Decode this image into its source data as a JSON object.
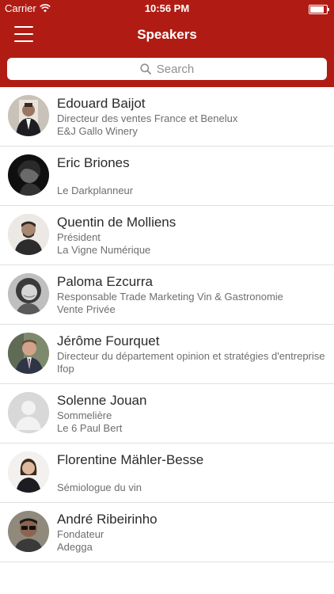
{
  "status_bar": {
    "carrier": "Carrier",
    "time": "10:56 PM",
    "battery_level": 0.95
  },
  "nav": {
    "title": "Speakers"
  },
  "search": {
    "placeholder": "Search"
  },
  "colors": {
    "header": "#b01c14",
    "text_secondary": "#6e6e6e"
  },
  "speakers": [
    {
      "name": "Edouard Baijot",
      "role": "Directeur des ventes France et Benelux",
      "company": "E&J Gallo Winery"
    },
    {
      "name": "Eric Briones",
      "role": "",
      "company": "Le Darkplanneur"
    },
    {
      "name": "Quentin de Molliens",
      "role": "Président",
      "company": "La Vigne Numérique"
    },
    {
      "name": "Paloma Ezcurra",
      "role": "Responsable Trade Marketing Vin & Gastronomie",
      "company": "Vente Privée"
    },
    {
      "name": "Jérôme Fourquet",
      "role": "Directeur du département opinion et stratégies d'entreprise",
      "company": "Ifop"
    },
    {
      "name": "Solenne Jouan",
      "role": "Sommelière",
      "company": "Le 6 Paul Bert"
    },
    {
      "name": "Florentine Mähler-Besse",
      "role": "",
      "company": "Sémiologue du vin"
    },
    {
      "name": "André Ribeirinho",
      "role": "Fondateur",
      "company": "Adegga"
    }
  ]
}
